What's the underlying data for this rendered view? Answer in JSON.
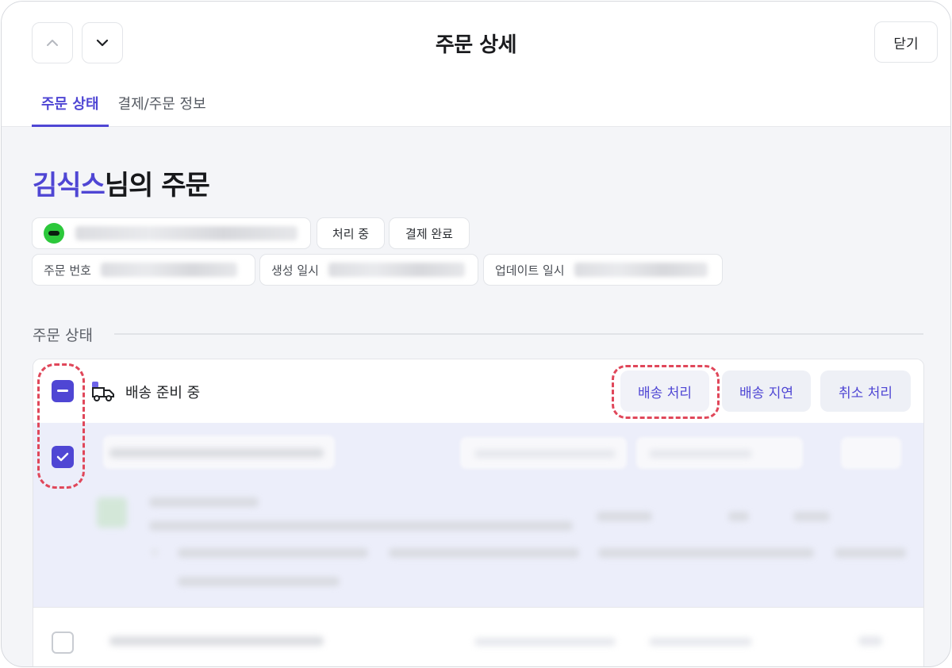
{
  "header": {
    "title": "주문 상세",
    "close_label": "닫기"
  },
  "tabs": [
    {
      "label": "주문 상태",
      "active": true
    },
    {
      "label": "결제/주문 정보",
      "active": false
    }
  ],
  "order": {
    "customer_name": "김식스",
    "title_suffix": "님의 주문",
    "status_chips": [
      "처리 중",
      "결제 완료"
    ],
    "meta_labels": {
      "order_number": "주문 번호",
      "created_at": "생성 일시",
      "updated_at": "업데이트 일시"
    }
  },
  "section": {
    "label": "주문 상태"
  },
  "panel": {
    "group_label": "배송 준비 중",
    "actions": {
      "ship": "배송 처리",
      "delay": "배송 지연",
      "cancel": "취소 처리"
    }
  },
  "colors": {
    "accent": "#4f46d4",
    "highlight": "#e0475a",
    "selected_row_bg": "#eceefa"
  }
}
